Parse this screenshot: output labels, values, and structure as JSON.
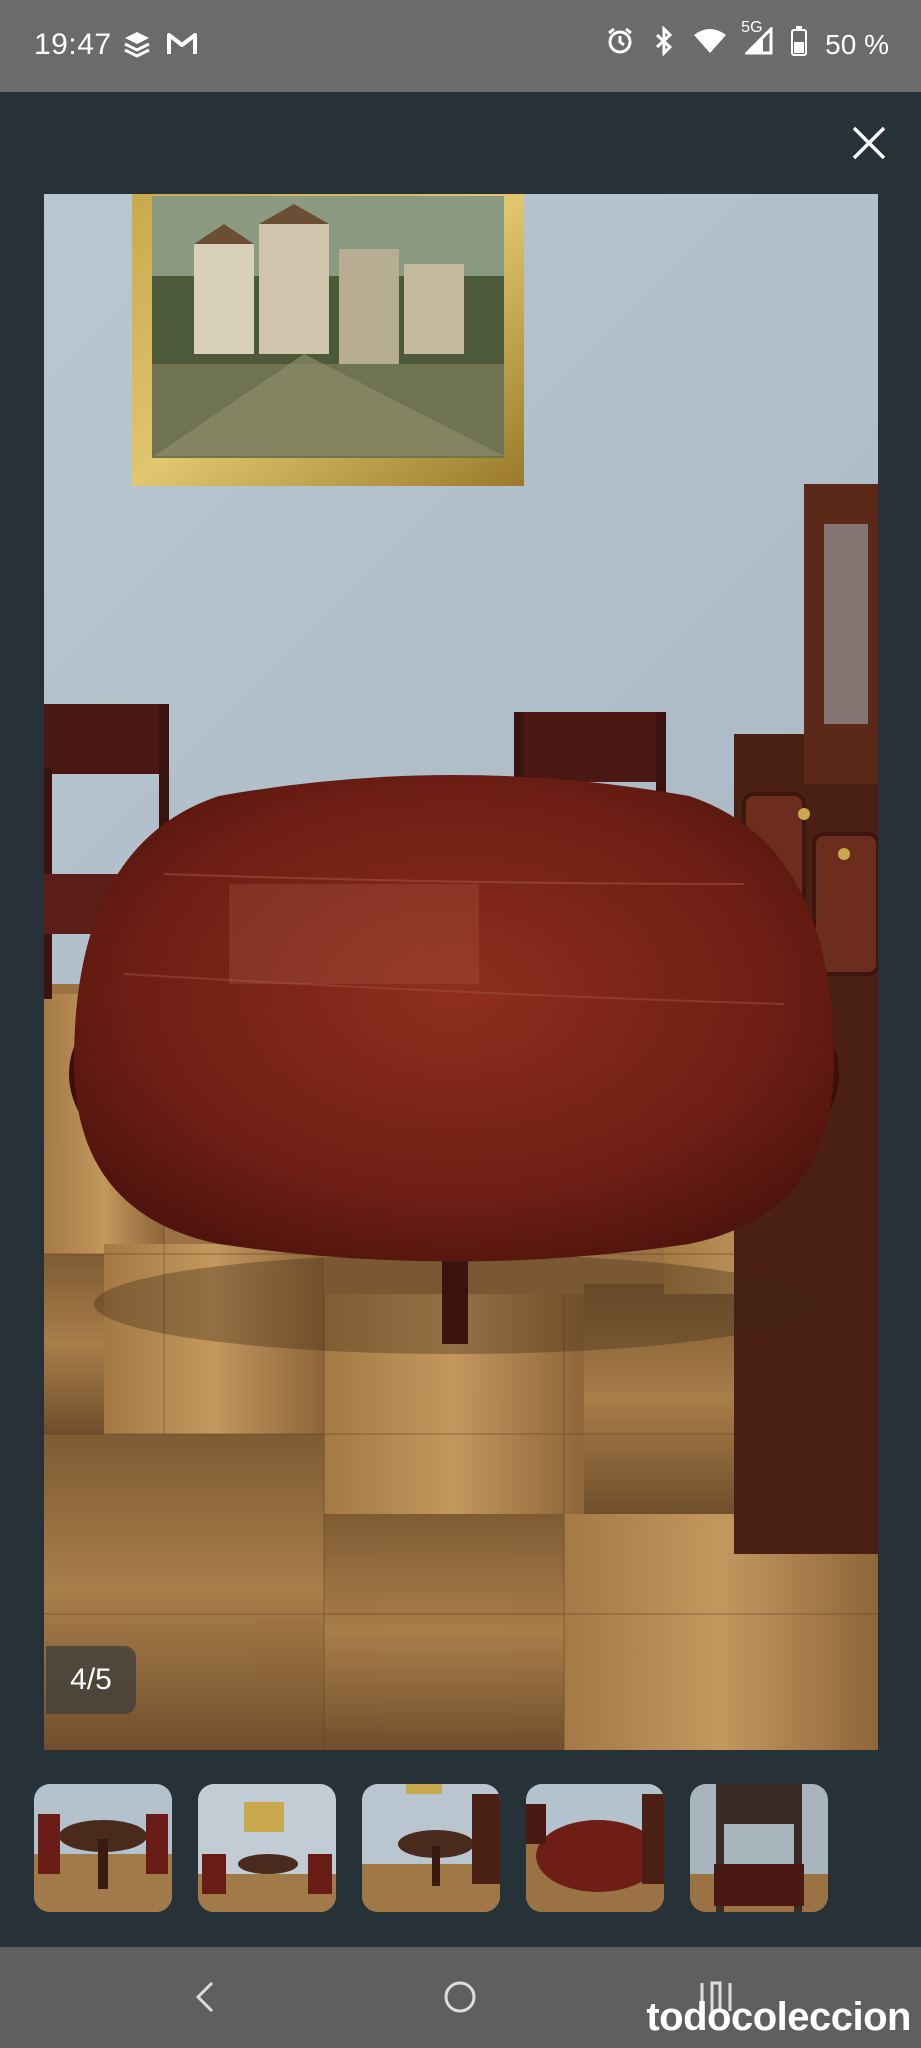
{
  "status_bar": {
    "time": "19:47",
    "left_icons": [
      "stack-icon",
      "gmail-icon"
    ],
    "right_icons": [
      "alarm-icon",
      "bluetooth-icon",
      "wifi-icon",
      "signal-icon",
      "battery-icon"
    ],
    "network_label": "5G",
    "battery_text": "50 %"
  },
  "viewer": {
    "close_icon": "close-icon",
    "counter": "4/5",
    "selected_index": 3,
    "thumbnails": [
      {
        "description": "round table with chairs"
      },
      {
        "description": "room with painting and table"
      },
      {
        "description": "table in dining room"
      },
      {
        "description": "extended oval table"
      },
      {
        "description": "wooden chair"
      }
    ]
  },
  "nav_bar": {
    "back_icon": "back-icon",
    "home_icon": "home-icon",
    "recents_icon": "recents-icon"
  },
  "watermark": "todocoleccion",
  "colors": {
    "background": "#263238",
    "status_bar": "#6b6b6b",
    "nav_bar": "#5f5f5f"
  }
}
